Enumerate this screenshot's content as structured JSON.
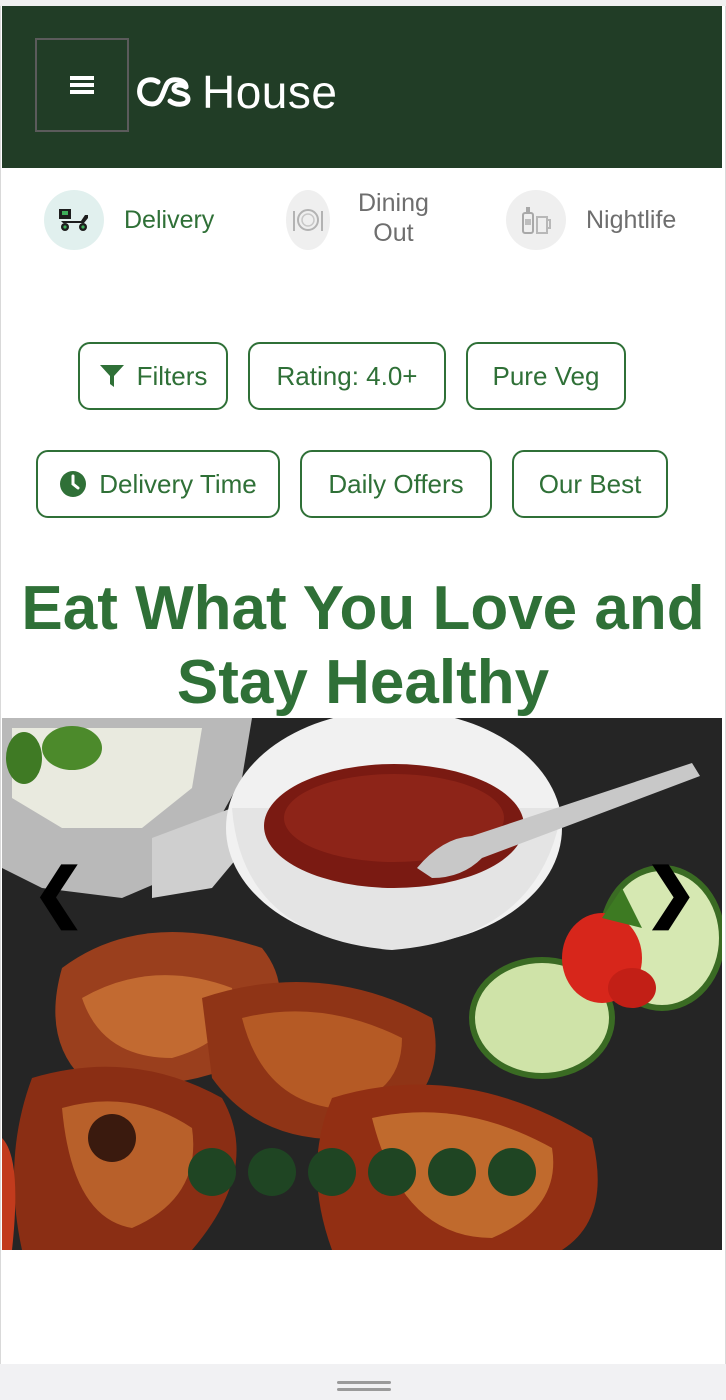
{
  "app": {
    "brand": "House",
    "brand_mark": "os-logo"
  },
  "colors": {
    "header_bg": "#213d26",
    "accent": "#2f7037",
    "dot": "#1f4523"
  },
  "categories": [
    {
      "label": "Delivery",
      "icon": "scooter-icon",
      "active": true
    },
    {
      "label": "Dining\nOut",
      "icon": "dining-plate-icon",
      "active": false
    },
    {
      "label": "Nightlife",
      "icon": "bottle-glass-icon",
      "active": false
    }
  ],
  "filters": {
    "row1": [
      {
        "label": "Filters",
        "icon": "filter-icon"
      },
      {
        "label": "Rating: 4.0+"
      },
      {
        "label": "Pure Veg"
      }
    ],
    "row2": [
      {
        "label": "Delivery Time",
        "icon": "clock-icon"
      },
      {
        "label": "Daily Offers"
      },
      {
        "label": "Our Best"
      }
    ]
  },
  "headline": {
    "line1": "Eat What You Love and",
    "line2": "Stay Healthy"
  },
  "carousel": {
    "prev_label": "❮",
    "next_label": "❯",
    "slide_count": 6,
    "image": "bbq-chicken-wings-with-sauce-and-cucumber"
  }
}
